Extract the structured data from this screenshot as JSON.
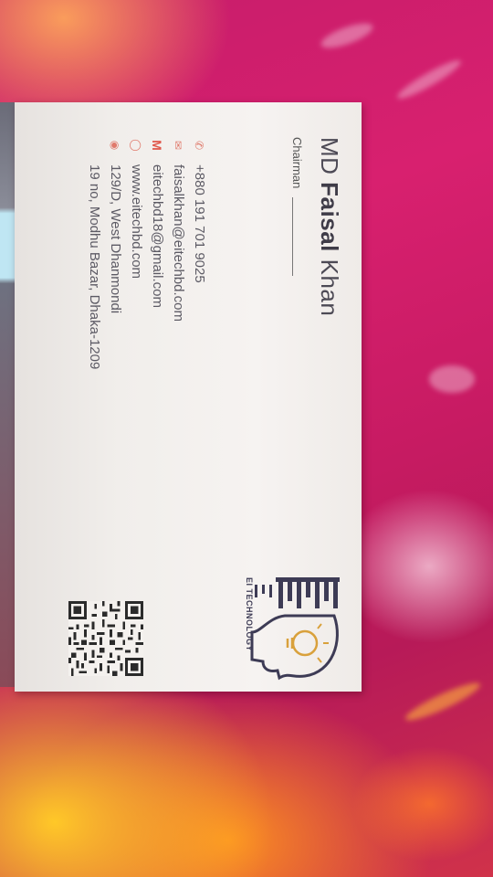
{
  "card": {
    "name_first": "MD",
    "name_middle": "Faisal",
    "name_last": "Khan",
    "title": "Chairman",
    "contacts": [
      {
        "icon": "phone-icon",
        "text": "+880 191 701 9025"
      },
      {
        "icon": "mail-icon",
        "text": "faisalkhan@eitechbd.com"
      },
      {
        "icon": "gmail-icon",
        "text": "eitechbd18@gmail.com"
      },
      {
        "icon": "globe-icon",
        "text": "www.eitechbd.com"
      },
      {
        "icon": "location-icon",
        "text": "129/D, West Dhanmondi"
      },
      {
        "icon": "",
        "text": "19 no, Modhu Bazar, Dhaka-1209"
      }
    ],
    "logo_text": "EI TECHNOLOGY"
  },
  "colors": {
    "accent": "#e07a6c",
    "text": "#5c5a64",
    "logo": "#3d3b55",
    "background": "#c61d6a"
  }
}
